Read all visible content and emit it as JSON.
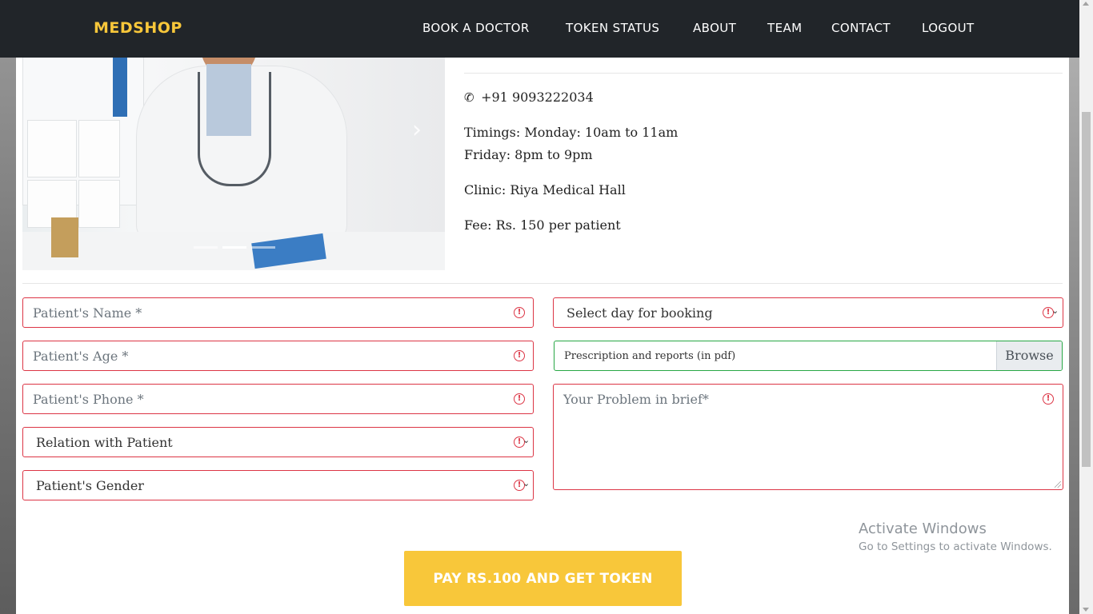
{
  "navbar": {
    "brand": "MEDSHOP",
    "links": [
      "BOOK A DOCTOR",
      "TOKEN STATUS",
      "ABOUT",
      "TEAM",
      "CONTACT",
      "LOGOUT"
    ]
  },
  "doctor_info": {
    "phone": "+91 9093222034",
    "timings_line1": "Timings: Monday: 10am to 11am",
    "timings_line2": "Friday: 8pm to 9pm",
    "clinic": "Clinic: Riya Medical Hall",
    "fee": "Fee: Rs. 150 per patient"
  },
  "form": {
    "name_placeholder": "Patient's Name *",
    "age_placeholder": "Patient's Age *",
    "phone_placeholder": "Patient's Phone *",
    "relation_selected": "Relation with Patient",
    "gender_selected": "Patient's Gender",
    "day_selected": "Select day for booking",
    "file_label": "Prescription and reports (in pdf)",
    "browse_label": "Browse",
    "problem_placeholder": "Your Problem in brief*"
  },
  "watermark": {
    "line1": "Activate Windows",
    "line2": "Go to Settings to activate Windows."
  },
  "submit_label": "PAY RS.100 AND GET TOKEN",
  "colors": {
    "brand": "#f8c73a",
    "navbar_bg": "#212529",
    "invalid": "#dc3545",
    "valid": "#28a745"
  }
}
